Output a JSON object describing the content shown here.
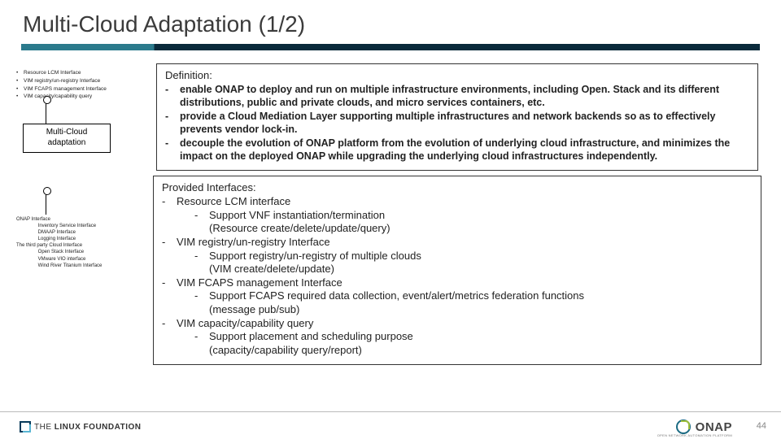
{
  "title": "Multi-Cloud Adaptation (1/2)",
  "left_bullets": [
    "Resource LCM Interface",
    "VIM registry/un-registry Interface",
    "VIM FCAPS management Interface",
    "VIM capacity/capability query"
  ],
  "mc_box_line1": "Multi-Cloud",
  "mc_box_line2": "adaptation",
  "onap_if": {
    "h1": "ONAP Interface",
    "l1": "Inventory Service Interface",
    "l2": "DMAAP Interface",
    "l3": "Logging Interface",
    "h2": "The third party Cloud Interface",
    "l4": "Open Stack Interface",
    "l5": "VMware VIO interface",
    "l6": "Wind River Titanium Interface"
  },
  "definition": {
    "heading": "Definition:",
    "items": [
      "enable ONAP to deploy and run on multiple infrastructure environments, including Open. Stack and its different distributions, public and private clouds, and micro services containers, etc.",
      "provide a Cloud Mediation Layer supporting multiple infrastructures and network backends so as to effectively prevents vendor lock-in.",
      "decouple the evolution of ONAP platform from the evolution of underlying cloud infrastructure, and minimizes the impact on the deployed ONAP while upgrading the underlying cloud infrastructures independently."
    ]
  },
  "provided": {
    "heading": "Provided Interfaces:",
    "rows": [
      {
        "lvl": 1,
        "text": "Resource LCM interface"
      },
      {
        "lvl": 2,
        "text": "Support VNF instantiation/termination"
      },
      {
        "lvl": 2,
        "text": "(Resource create/delete/update/query)",
        "nodash": true
      },
      {
        "lvl": 1,
        "text": "VIM registry/un-registry Interface"
      },
      {
        "lvl": 2,
        "text": "Support registry/un-registry of multiple clouds"
      },
      {
        "lvl": 2,
        "text": "(VIM create/delete/update)",
        "nodash": true
      },
      {
        "lvl": 1,
        "text": "VIM FCAPS management Interface"
      },
      {
        "lvl": 2,
        "text": "Support FCAPS required data collection, event/alert/metrics federation functions"
      },
      {
        "lvl": 2,
        "text": "(message pub/sub)",
        "nodash": true
      },
      {
        "lvl": 1,
        "text": "VIM capacity/capability query"
      },
      {
        "lvl": 2,
        "text": "Support placement and scheduling purpose"
      },
      {
        "lvl": 2,
        "text": "(capacity/capability query/report)",
        "nodash": true
      }
    ]
  },
  "footer": {
    "lf_the": "THE",
    "lf_name": "LINUX FOUNDATION",
    "onap": "ONAP",
    "onap_sub": "OPEN NETWORK AUTOMATION PLATFORM",
    "page": "44"
  }
}
